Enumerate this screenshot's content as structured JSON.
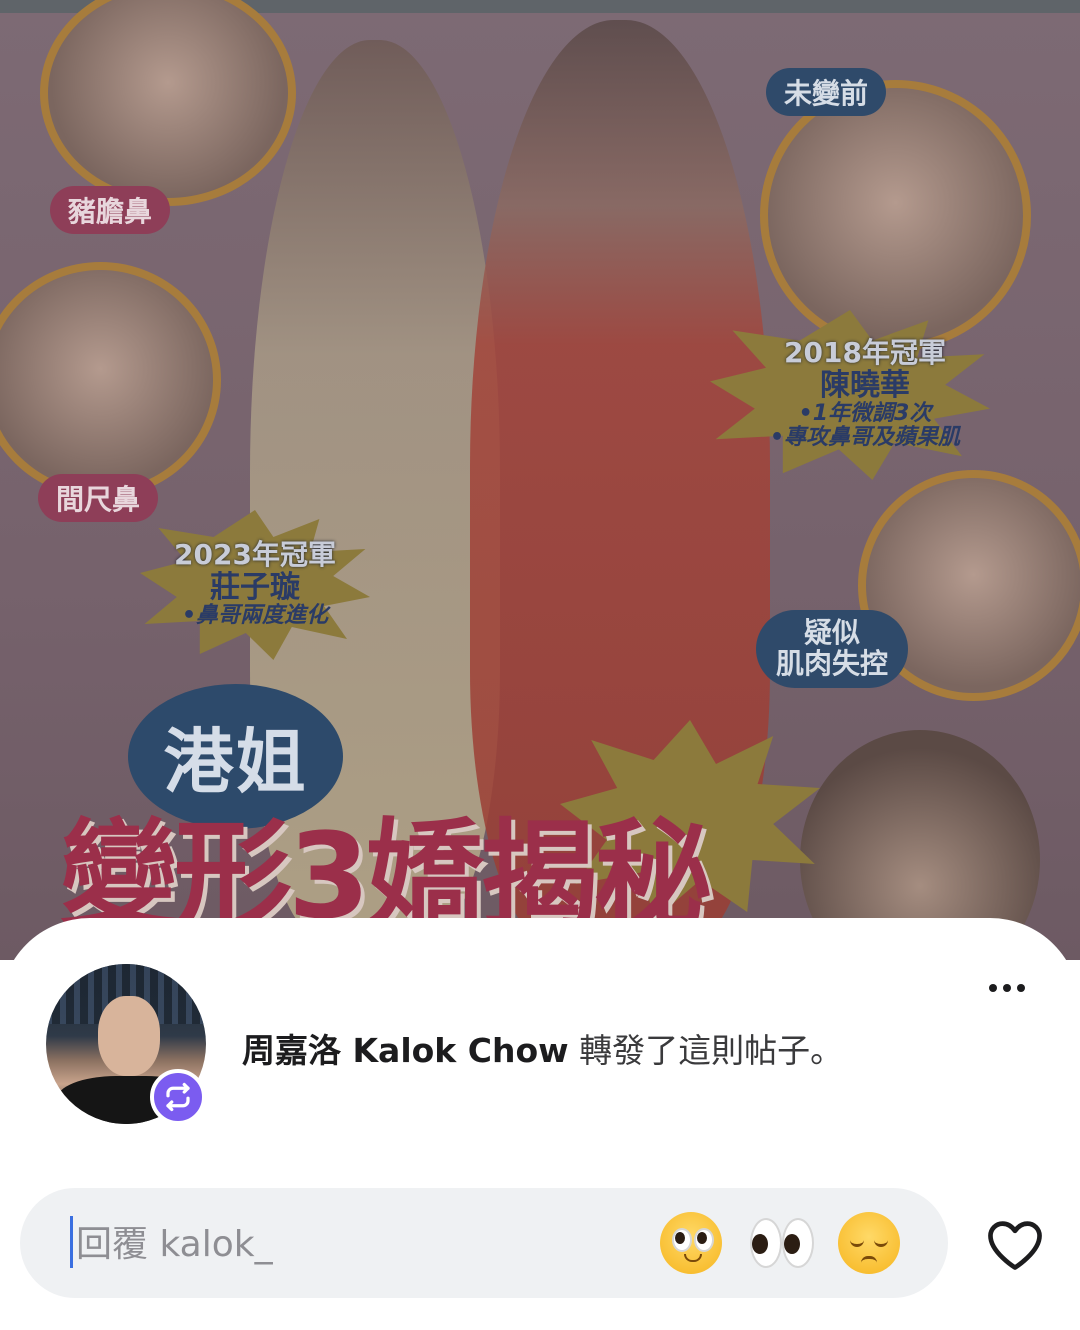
{
  "post_image": {
    "left_circle_labels": [
      "豬膽鼻",
      "間尺鼻"
    ],
    "right_top_label": "未變前",
    "right_bottom_label": "疑似\n肌肉失控",
    "burst_left": {
      "year": "2023年冠軍",
      "name": "莊子璇",
      "note": "•鼻哥兩度進化"
    },
    "burst_right": {
      "year": "2018年冠軍",
      "name": "陳曉華",
      "note1": "•1年微調3次",
      "note2": "•專攻鼻哥及蘋果肌"
    },
    "badge_text": "港姐",
    "headline": "變形3嬌揭秘"
  },
  "repost": {
    "user_name": "周嘉洛 Kalok Chow",
    "action_text": " 轉發了這則帖子。"
  },
  "reply": {
    "placeholder": "回覆 kalok_",
    "quick_emojis": [
      "🥺",
      "👀",
      "😔"
    ]
  },
  "colors": {
    "repost_badge": "#7b5cf0",
    "caret": "#3a6fe0",
    "reply_bar_bg": "#eff1f3"
  },
  "icons": {
    "more": "more-horizontal-icon",
    "repost": "repost-icon",
    "like": "heart-outline-icon"
  }
}
